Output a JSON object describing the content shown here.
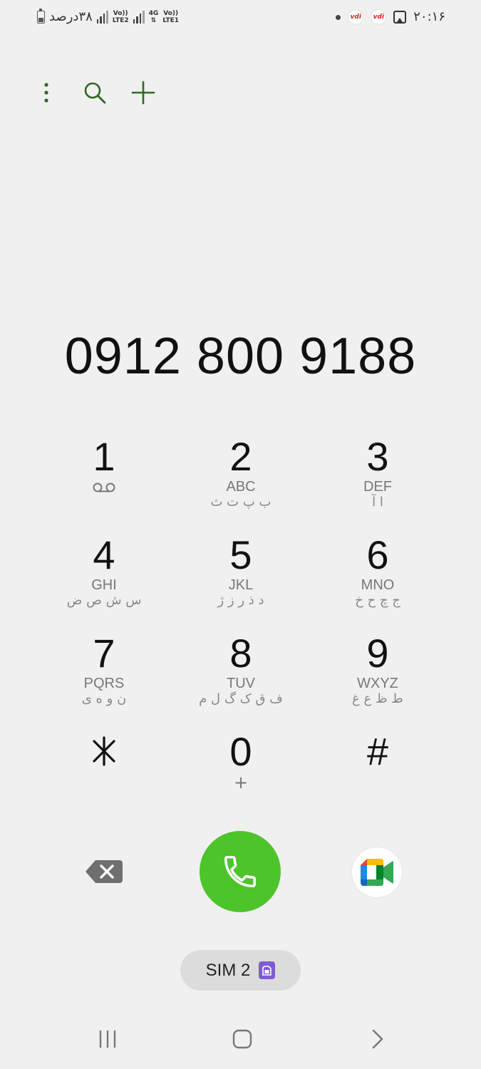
{
  "status_bar": {
    "battery_text": "۳۸درصد",
    "battery_level": 0.38,
    "sim2_label_top": "Vo))",
    "sim2_label_bottom": "LTE2",
    "sim1_label_top": "4G",
    "sim1_volte_top": "Vo))",
    "sim1_volte_bottom": "LTE1",
    "carrier_badge_1": "vdi",
    "carrier_badge_2": "vdi",
    "clock": "۲۰:۱۶"
  },
  "action_bar": {
    "more_icon": "more-vertical-icon",
    "search_icon": "search-icon",
    "add_icon": "plus-icon"
  },
  "dialed_number": "0912 800 9188",
  "keypad": {
    "keys": [
      {
        "digit": "1",
        "letters": "",
        "persian": ""
      },
      {
        "digit": "2",
        "letters": "ABC",
        "persian": "ب پ ت ث"
      },
      {
        "digit": "3",
        "letters": "DEF",
        "persian": "ا آ"
      },
      {
        "digit": "4",
        "letters": "GHI",
        "persian": "س ش ص ض"
      },
      {
        "digit": "5",
        "letters": "JKL",
        "persian": "د ذ ر ز ژ"
      },
      {
        "digit": "6",
        "letters": "MNO",
        "persian": "ج چ ح خ"
      },
      {
        "digit": "7",
        "letters": "PQRS",
        "persian": "ن و ه ی"
      },
      {
        "digit": "8",
        "letters": "TUV",
        "persian": "ف ق ک گ ل م"
      },
      {
        "digit": "9",
        "letters": "WXYZ",
        "persian": "ط ظ ع غ"
      },
      {
        "digit": "*",
        "letters": "",
        "persian": ""
      },
      {
        "digit": "0",
        "letters": "+",
        "persian": ""
      },
      {
        "digit": "#",
        "letters": "",
        "persian": ""
      }
    ]
  },
  "controls": {
    "backspace_icon": "backspace-icon",
    "call_icon": "phone-icon",
    "video_icon": "google-meet-icon"
  },
  "sim_selector": {
    "label": "SIM 2",
    "color": "#7e5cd4"
  },
  "nav": {
    "recents_icon": "recent-apps-icon",
    "home_icon": "home-icon",
    "back_icon": "back-icon"
  },
  "colors": {
    "accent": "#2e6b1f",
    "call_green": "#4dc42a",
    "background": "#f0f0f0"
  }
}
